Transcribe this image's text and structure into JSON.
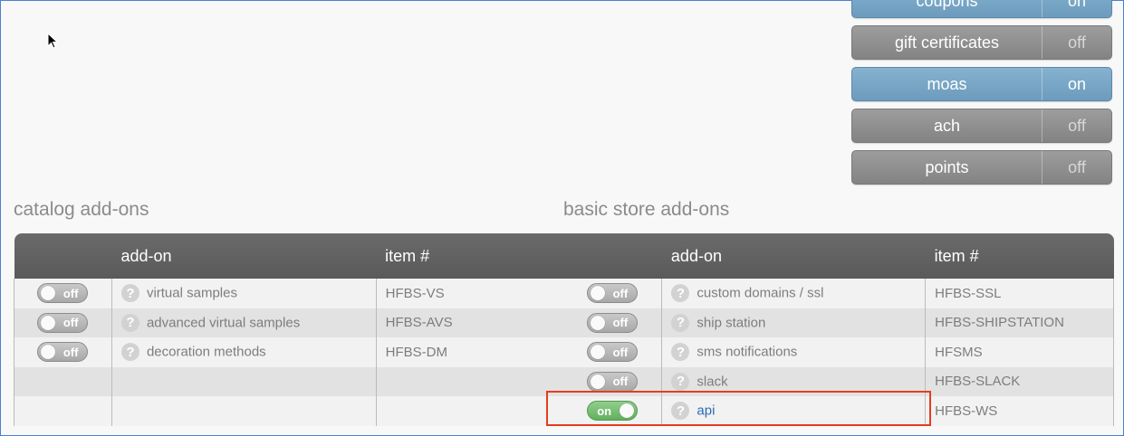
{
  "side_toggles": [
    {
      "label": "coupons",
      "state": "on"
    },
    {
      "label": "gift certificates",
      "state": "off"
    },
    {
      "label": "moas",
      "state": "on"
    },
    {
      "label": "ach",
      "state": "off"
    },
    {
      "label": "points",
      "state": "off"
    }
  ],
  "catalog": {
    "title": "catalog add-ons",
    "headers": {
      "toggle": "",
      "addon": "add-on",
      "item": "item #"
    },
    "rows": [
      {
        "toggle": "off",
        "addon": "virtual samples",
        "item": "HFBS-VS"
      },
      {
        "toggle": "off",
        "addon": "advanced virtual samples",
        "item": "HFBS-AVS"
      },
      {
        "toggle": "off",
        "addon": "decoration methods",
        "item": "HFBS-DM"
      }
    ]
  },
  "basic_store": {
    "title": "basic store add-ons",
    "headers": {
      "toggle": "",
      "addon": "add-on",
      "item": "item #"
    },
    "rows": [
      {
        "toggle": "off",
        "addon": "custom domains / ssl",
        "item": "HFBS-SSL"
      },
      {
        "toggle": "off",
        "addon": "ship station",
        "item": "HFBS-SHIPSTATION"
      },
      {
        "toggle": "off",
        "addon": "sms notifications",
        "item": "HFSMS"
      },
      {
        "toggle": "off",
        "addon": "slack",
        "item": "HFBS-SLACK"
      },
      {
        "toggle": "on",
        "addon": "api",
        "item": "HFBS-WS"
      }
    ]
  },
  "help_glyph": "?",
  "colors": {
    "on_blue": "#6c9bbd",
    "off_gray": "#838383",
    "highlight": "#e53d1e",
    "toggle_on": "#63b05f",
    "link": "#2b6cb4"
  }
}
